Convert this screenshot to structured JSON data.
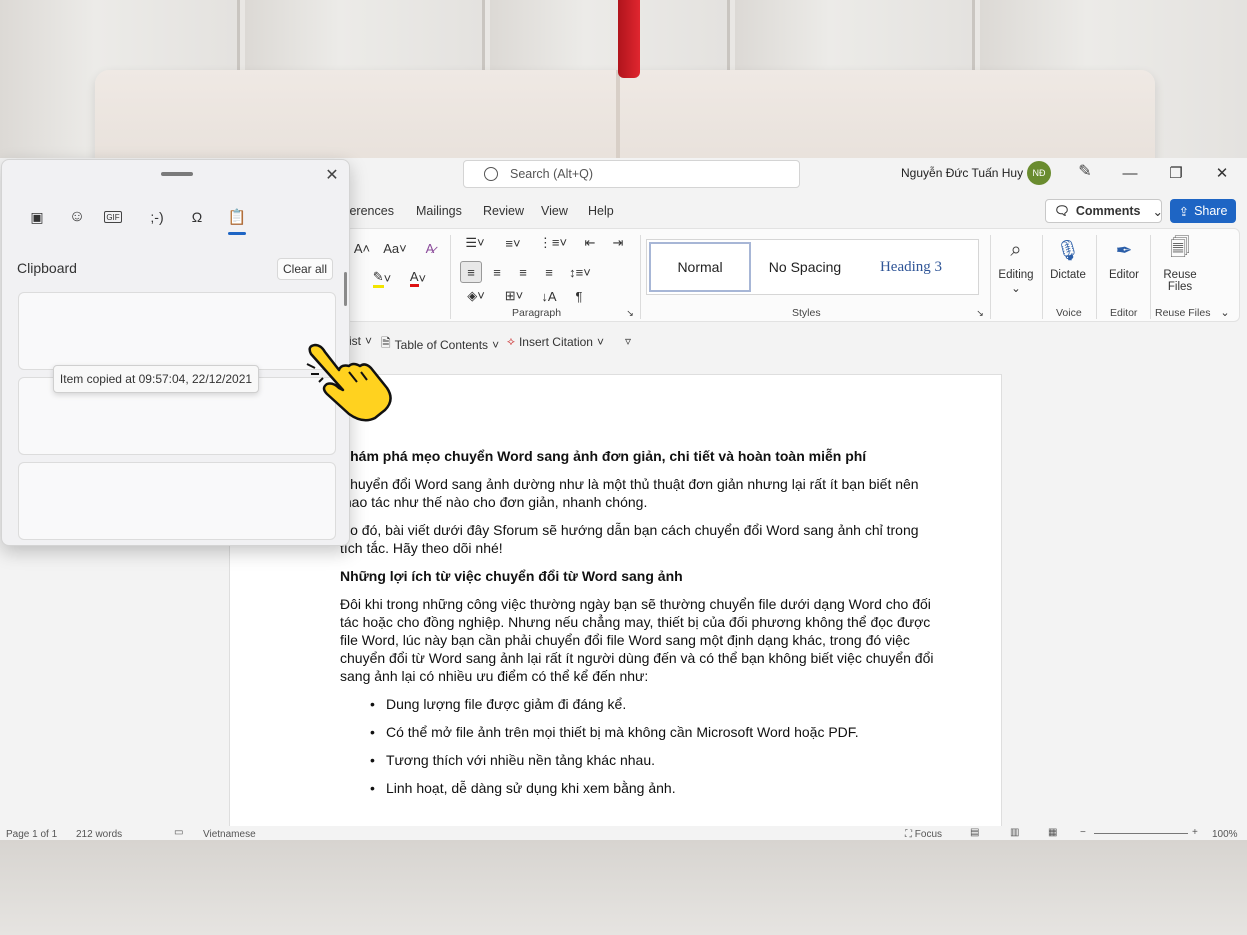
{
  "search": {
    "placeholder": "Search (Alt+Q)"
  },
  "user": {
    "name": "Nguyễn Đức Tuấn Huy",
    "initials": "NĐ"
  },
  "window": {
    "minimize": "—",
    "restore": "❐",
    "close": "✕"
  },
  "tabs": [
    "ferences",
    "Mailings",
    "Review",
    "View",
    "Help"
  ],
  "actions": {
    "comments": "Comments",
    "share": "Share"
  },
  "ribbon": {
    "groups": {
      "paragraph": "Paragraph",
      "styles": "Styles",
      "voice": "Voice",
      "editor": "Editor",
      "reuse": "Reuse Files"
    },
    "styles": [
      "Normal",
      "No Spacing",
      "Heading 3"
    ],
    "buttons": {
      "editing": "Editing",
      "dictate": "Dictate",
      "editor": "Editor",
      "reuse_files_line1": "Reuse",
      "reuse_files_line2": "Files"
    }
  },
  "qat": {
    "list": "ist",
    "toc": "Table of Contents",
    "citation": "Insert Citation"
  },
  "clipboard": {
    "title": "Clipboard",
    "clear_all": "Clear all",
    "tooltip": "Item copied at 09:57:04, 22/12/2021",
    "tabs": [
      "favorites-icon",
      "emoji-icon",
      "gif-icon",
      "kaomoji-icon",
      "symbols-icon",
      "clipboard-icon"
    ],
    "tab_glyphs": {
      "gif": "GIF",
      "kaomoji": ";-)",
      "symbols": "Ω"
    }
  },
  "document": {
    "title": "Khám phá mẹo chuyển Word sang ảnh đơn giản, chi tiết và hoàn toàn miễn phí",
    "p1": "Chuyển đổi Word sang ảnh dường như là một thủ thuật đơn giản nhưng lại rất ít bạn biết nên thao tác như thế nào cho đơn giản, nhanh chóng.",
    "p2": "Do đó, bài viết dưới đây Sforum sẽ hướng dẫn bạn cách chuyển đổi Word sang ảnh chỉ trong tích tắc. Hãy theo dõi nhé!",
    "h2": "Những lợi ích từ việc chuyển đổi từ Word sang ảnh",
    "p3": "Đôi khi trong những công việc thường ngày bạn sẽ thường chuyển file dưới dạng Word cho đối tác hoặc cho đồng nghiệp. Nhưng nếu chẳng may, thiết bị của đối phương không thể đọc được file Word, lúc này bạn cần phải chuyển đổi file Word sang một định dạng khác, trong đó việc chuyển đổi từ Word sang ảnh lại rất ít người dùng đến và có thể bạn không biết việc chuyển đổi sang ảnh lại có nhiều ưu điểm có thể kể đến như:",
    "bullets": [
      "Dung lượng file được giảm đi đáng kể.",
      "Có thể mở file ảnh trên mọi thiết bị mà không cần Microsoft Word hoặc PDF.",
      "Tương thích với nhiều nền tảng khác nhau.",
      "Linh hoạt, dễ dàng sử dụng khi xem bằng ảnh."
    ]
  },
  "status": {
    "page": "Page 1 of 1",
    "words": "212 words",
    "language": "Vietnamese",
    "focus": "Focus",
    "zoom": "100%"
  }
}
